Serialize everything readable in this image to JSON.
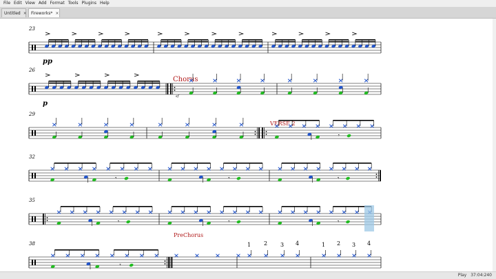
{
  "menu": [
    "File",
    "Edit",
    "View",
    "Add",
    "Format",
    "Tools",
    "Plugins",
    "Help"
  ],
  "tabs": [
    {
      "label": "Untitled",
      "close": "×",
      "active": false
    },
    {
      "label": "Fireworks*",
      "close": "×",
      "active": true
    }
  ],
  "score": {
    "systems": [
      {
        "measure": "23",
        "dynamic": "pp"
      },
      {
        "measure": "26",
        "dynamic": "p",
        "rehearsal": "Chorus"
      },
      {
        "measure": "29",
        "rehearsal": "VERSE 2"
      },
      {
        "measure": "32"
      },
      {
        "measure": "35"
      },
      {
        "measure": "38",
        "rehearsal": "PreChorus",
        "counts": [
          "1",
          "2",
          "3",
          "4",
          "1",
          "2",
          "3",
          "4"
        ]
      }
    ],
    "colors": {
      "blue": "#2255cc",
      "green": "#22bb22",
      "rehearsal": "#b01818",
      "selection": "#9ec8e6"
    }
  },
  "status": {
    "mode": "Play",
    "time": "37:04:240"
  }
}
